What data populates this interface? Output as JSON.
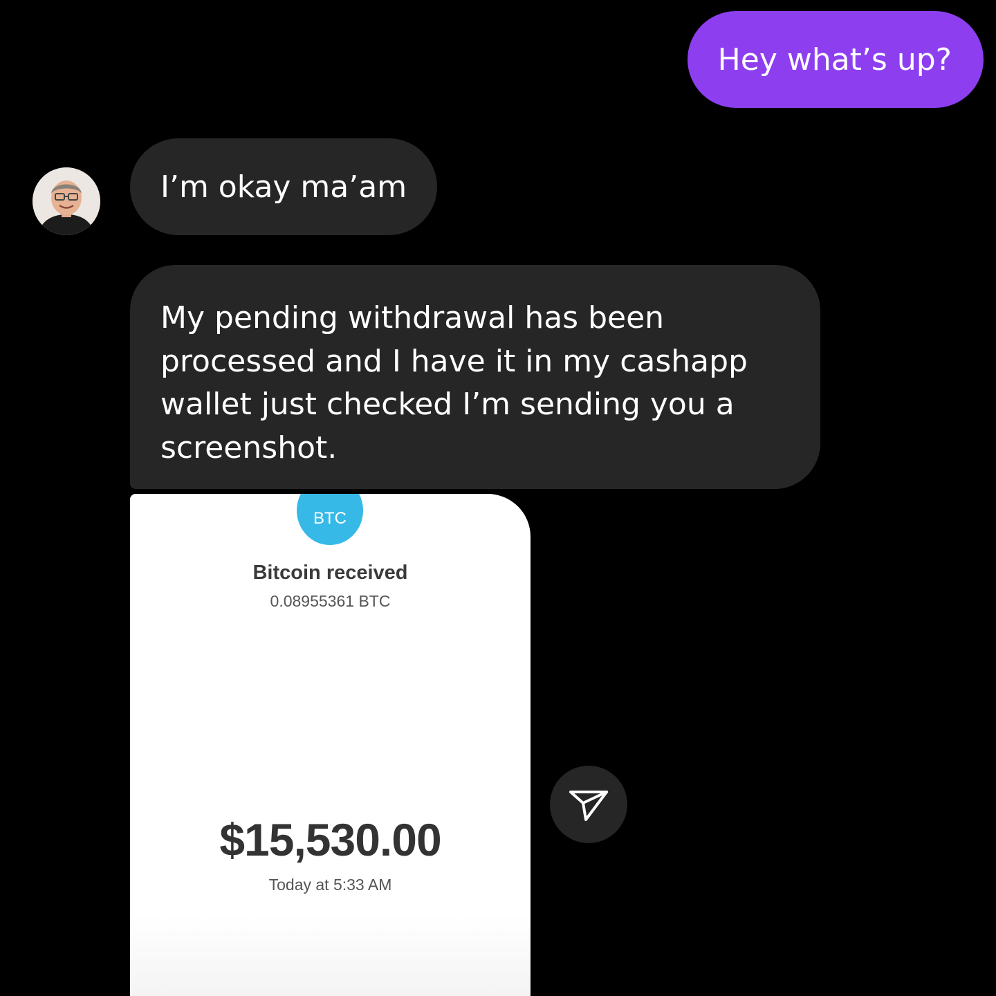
{
  "colors": {
    "outgoing_bubble": "#8d3ff0",
    "incoming_bubble": "#262626",
    "background": "#000000",
    "btc_badge": "#36b9e6",
    "share_button": "#262626"
  },
  "messages": {
    "outgoing_1": "Hey what’s up?",
    "incoming_1": "I’m okay ma’am",
    "incoming_2": "My pending withdrawal has been processed and I have it in my cashapp wallet just checked I’m sending you a screenshot."
  },
  "receipt": {
    "badge_label": "BTC",
    "title": "Bitcoin received",
    "btc_amount": "0.08955361 BTC",
    "usd_amount": "$15,530.00",
    "timestamp": "Today at 5:33 AM"
  },
  "icons": {
    "share": "paper-plane-icon",
    "avatar": "user-avatar"
  }
}
